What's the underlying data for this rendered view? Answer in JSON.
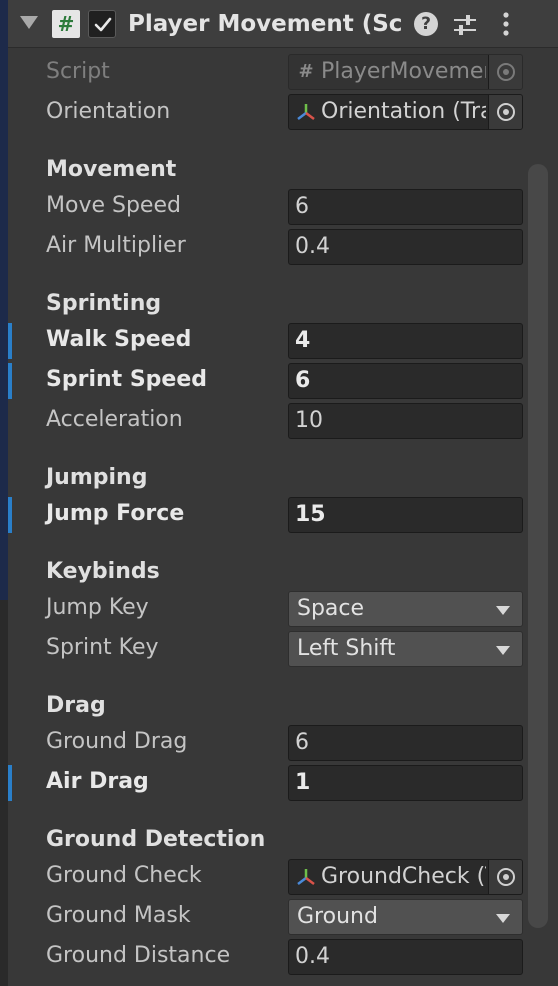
{
  "header": {
    "script_icon_glyph": "#",
    "title": "Player Movement (Script)",
    "help_glyph": "?",
    "enabled": true
  },
  "fields": [
    {
      "id": "script",
      "label": "Script",
      "kind": "object",
      "value": "PlayerMovement",
      "icon": "script-icon",
      "disabled": true
    },
    {
      "id": "orientation",
      "label": "Orientation",
      "kind": "object",
      "value": "Orientation (Transform)",
      "icon": "transform-icon"
    }
  ],
  "sections": {
    "movement": {
      "title": "Movement",
      "move_speed": {
        "label": "Move Speed",
        "value": "6"
      },
      "air_multiplier": {
        "label": "Air Multiplier",
        "value": "0.4"
      }
    },
    "sprinting": {
      "title": "Sprinting",
      "walk_speed": {
        "label": "Walk Speed",
        "value": "4",
        "overridden": true
      },
      "sprint_speed": {
        "label": "Sprint Speed",
        "value": "6",
        "overridden": true
      },
      "acceleration": {
        "label": "Acceleration",
        "value": "10"
      }
    },
    "jumping": {
      "title": "Jumping",
      "jump_force": {
        "label": "Jump Force",
        "value": "15",
        "overridden": true
      }
    },
    "keybinds": {
      "title": "Keybinds",
      "jump_key": {
        "label": "Jump Key",
        "value": "Space"
      },
      "sprint_key": {
        "label": "Sprint Key",
        "value": "Left Shift"
      }
    },
    "drag": {
      "title": "Drag",
      "ground_drag": {
        "label": "Ground Drag",
        "value": "6"
      },
      "air_drag": {
        "label": "Air Drag",
        "value": "1",
        "overridden": true
      }
    },
    "ground_detection": {
      "title": "Ground Detection",
      "ground_check": {
        "label": "Ground Check",
        "value": "GroundCheck (Transform)",
        "icon": "transform-icon"
      },
      "ground_mask": {
        "label": "Ground Mask",
        "value": "Ground"
      },
      "ground_distance": {
        "label": "Ground Distance",
        "value": "0.4"
      }
    }
  },
  "colors": {
    "background": "#383838",
    "field": "#2a2a2a",
    "override_accent": "#2a7fc9",
    "dropdown": "#515151"
  }
}
